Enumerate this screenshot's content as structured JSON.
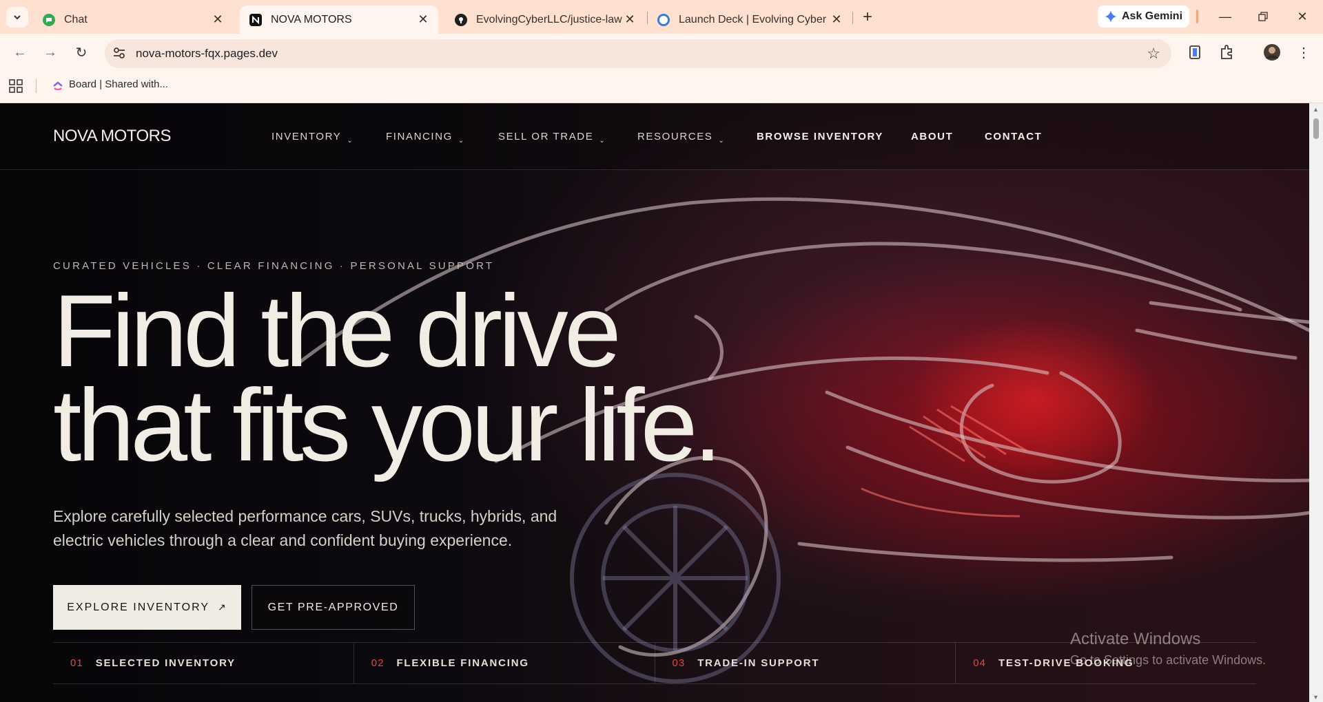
{
  "browser": {
    "tabs": [
      {
        "title": "Chat",
        "favicon": "google-chat-icon",
        "color": "#34a853"
      },
      {
        "title": "NOVA MOTORS",
        "favicon": "nova-motors-icon",
        "color": "#111111"
      },
      {
        "title": "EvolvingCyberLLC/justice-law",
        "favicon": "github-icon",
        "color": "#1f1f1f"
      },
      {
        "title": "Launch Deck | Evolving Cyber",
        "favicon": "evolving-cyber-icon",
        "color": "#3a7bd5"
      }
    ],
    "gemini_label": "Ask Gemini",
    "url": "nova-motors-fqx.pages.dev",
    "bookmark_label": "Board | Shared with..."
  },
  "site": {
    "logo": "NOVA MOTORS",
    "nav": [
      {
        "label": "INVENTORY",
        "dropdown": true
      },
      {
        "label": "FINANCING",
        "dropdown": true
      },
      {
        "label": "SELL OR TRADE",
        "dropdown": true
      },
      {
        "label": "RESOURCES",
        "dropdown": true
      },
      {
        "label": "BROWSE INVENTORY",
        "dropdown": false
      },
      {
        "label": "ABOUT",
        "dropdown": false
      },
      {
        "label": "CONTACT",
        "dropdown": false
      }
    ],
    "chevron": "⌄"
  },
  "hero": {
    "kicker": "CURATED VEHICLES · CLEAR FINANCING · PERSONAL SUPPORT",
    "headline_line1": "Find the drive",
    "headline_line2": "that fits your life.",
    "subtext": "Explore carefully selected performance cars, SUVs, trucks, hybrids, and electric vehicles through a clear and confident buying experience.",
    "primary_cta": "EXPLORE INVENTORY",
    "primary_cta_icon": "↗",
    "secondary_cta": "GET PRE-APPROVED"
  },
  "features": [
    {
      "num": "01",
      "label": "SELECTED INVENTORY"
    },
    {
      "num": "02",
      "label": "FLEXIBLE FINANCING"
    },
    {
      "num": "03",
      "label": "TRADE-IN SUPPORT"
    },
    {
      "num": "04",
      "label": "TEST-DRIVE BOOKING"
    }
  ],
  "windows_watermark": {
    "line1": "Activate Windows",
    "line2": "Go to Settings to activate Windows."
  },
  "colors": {
    "accent": "#e2483e",
    "cream": "#f1ece3",
    "chrome": "#fde0cf"
  }
}
